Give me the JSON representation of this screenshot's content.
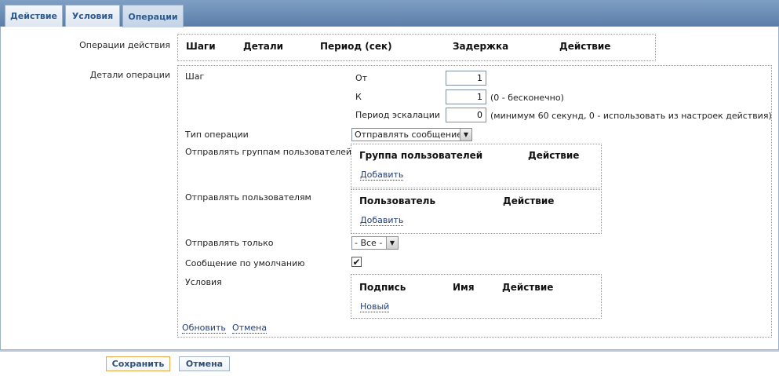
{
  "tabs": [
    {
      "label": "Действие"
    },
    {
      "label": "Условия"
    },
    {
      "label": "Операции"
    }
  ],
  "operations_section": {
    "label": "Операции действия",
    "columns": [
      "Шаги",
      "Детали",
      "Период (сек)",
      "Задержка",
      "Действие"
    ]
  },
  "details_section": {
    "label": "Детали операции",
    "step": {
      "label": "Шаг",
      "from_label": "От",
      "from_value": "1",
      "to_label": "К",
      "to_value": "1",
      "to_note": "(0 - бесконечно)",
      "escalation_label": "Период эскалации",
      "escalation_value": "0",
      "escalation_note": "(минимум 60 секунд, 0 - использовать из настроек действия)"
    },
    "operation_type": {
      "label": "Тип операции",
      "selected": "Отправлять сообщение"
    },
    "send_to_groups": {
      "label": "Отправлять группам пользователей",
      "columns": [
        "Группа пользователей",
        "Действие"
      ],
      "add_link": "Добавить"
    },
    "send_to_users": {
      "label": "Отправлять пользователям",
      "columns": [
        "Пользователь",
        "Действие"
      ],
      "add_link": "Добавить"
    },
    "send_only": {
      "label": "Отправлять только",
      "selected": "- Все -"
    },
    "default_message": {
      "label": "Сообщение по умолчанию",
      "checked": true
    },
    "conditions": {
      "label": "Условия",
      "columns": [
        "Подпись",
        "Имя",
        "Действие"
      ],
      "new_link": "Новый"
    },
    "update_link": "Обновить",
    "cancel_link": "Отмена"
  },
  "footer": {
    "save_label": "Сохранить",
    "cancel_label": "Отмена"
  },
  "colors": {
    "tabbar": "#6a8db6",
    "link": "#23407a",
    "border": "#8a97c9",
    "save_border": "#e6a94a"
  }
}
